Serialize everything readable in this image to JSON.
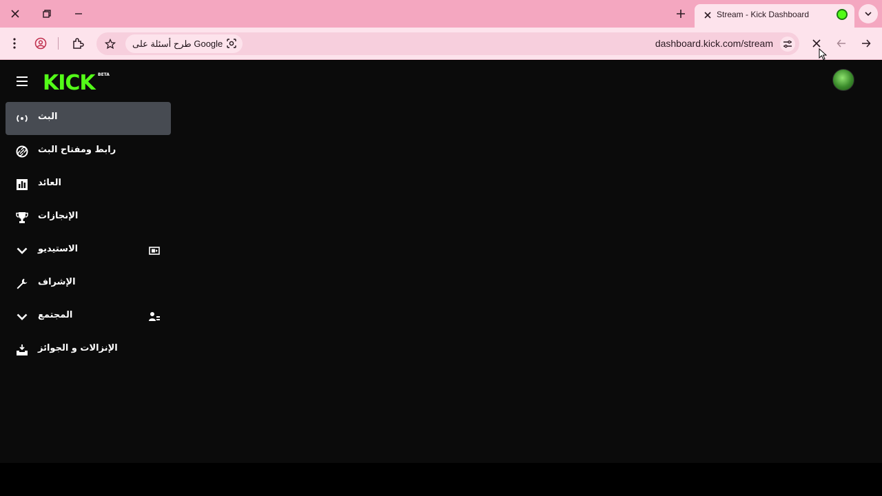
{
  "browser": {
    "tab_title": "Stream - Kick Dashboard",
    "url": "dashboard.kick.com/stream",
    "omnibox_chip": "طرح أسئلة على Google",
    "colors": {
      "tabbar": "#f4a7c0",
      "toolbar": "#fde3ec"
    }
  },
  "app": {
    "logo_text": "KICK",
    "logo_badge": "BETA",
    "accent_color": "#53fc18",
    "nav": [
      {
        "label": "البث",
        "icon": "broadcast-icon",
        "active": true
      },
      {
        "label": "رابط ومفتاح البث",
        "icon": "link-icon",
        "active": false
      },
      {
        "label": "العائد",
        "icon": "bar-chart-icon",
        "active": false
      },
      {
        "label": "الإنجازات",
        "icon": "trophy-icon",
        "active": false
      },
      {
        "label": "الاستيديو",
        "icon": "chevron-down-icon",
        "extra_icon": "studio-icon",
        "active": false
      },
      {
        "label": "الإشراف",
        "icon": "wrench-icon",
        "active": false
      },
      {
        "label": "المجتمع",
        "icon": "chevron-down-icon",
        "extra_icon": "community-icon",
        "active": false
      },
      {
        "label": "الإنزالات و الجوائز",
        "icon": "drops-icon",
        "active": false
      }
    ]
  }
}
